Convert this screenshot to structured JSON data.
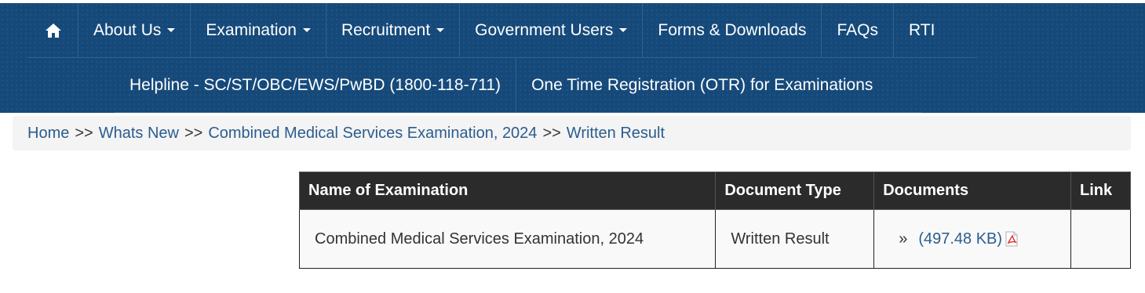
{
  "nav": {
    "home_icon": "home-icon",
    "row1": [
      {
        "label": "About Us",
        "dropdown": true
      },
      {
        "label": "Examination",
        "dropdown": true
      },
      {
        "label": "Recruitment",
        "dropdown": true
      },
      {
        "label": "Government Users",
        "dropdown": true
      },
      {
        "label": "Forms & Downloads",
        "dropdown": false
      },
      {
        "label": "FAQs",
        "dropdown": false
      },
      {
        "label": "RTI",
        "dropdown": false
      }
    ],
    "row2": [
      {
        "label": "Helpline - SC/ST/OBC/EWS/PwBD (1800-118-711)"
      },
      {
        "label": "One Time Registration (OTR) for Examinations"
      }
    ]
  },
  "breadcrumb": {
    "items": [
      "Home",
      "Whats New",
      "Combined Medical Services Examination, 2024",
      "Written Result"
    ],
    "separator": ">>"
  },
  "table": {
    "headers": [
      "Name of Examination",
      "Document Type",
      "Documents",
      "Link"
    ],
    "rows": [
      {
        "name": "Combined Medical Services Examination, 2024",
        "type": "Written Result",
        "bullet": "»",
        "document": "(497.48 KB)",
        "document_icon": "pdf-icon",
        "link": ""
      }
    ]
  },
  "colors": {
    "navbar": "#15497a",
    "link": "#2a5d8f",
    "table_header": "#2b2b2b"
  }
}
